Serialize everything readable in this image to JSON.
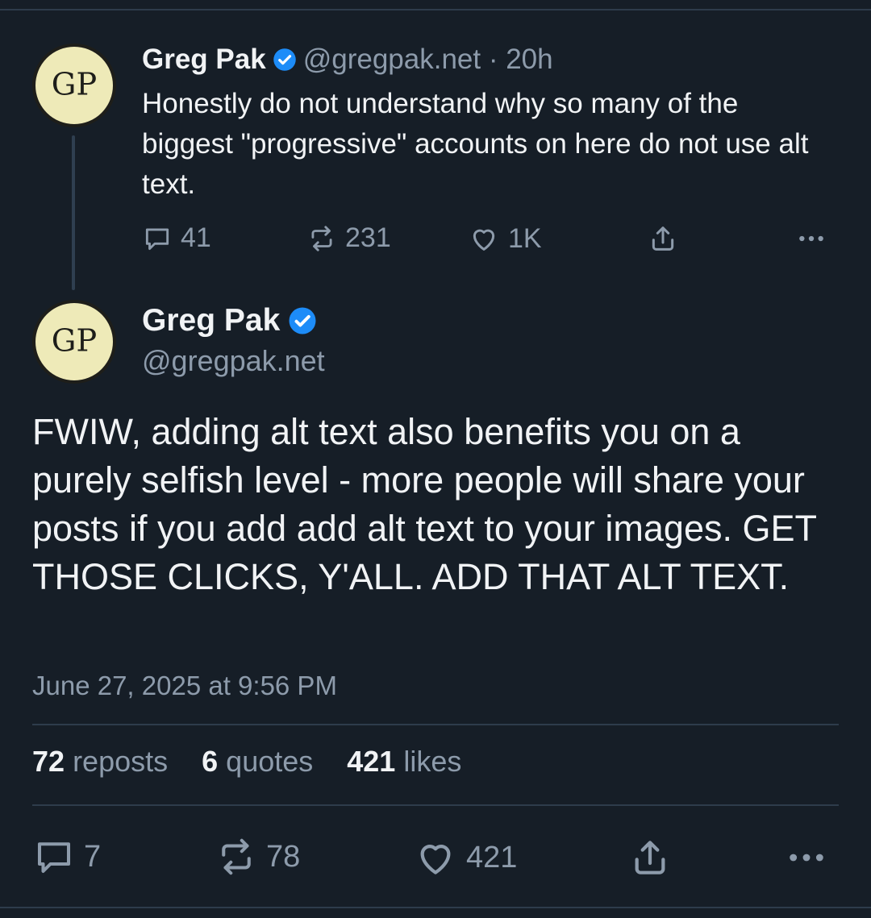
{
  "parent_post": {
    "author_name": "Greg Pak",
    "handle_time": "@gregpak.net · 20h",
    "text": "Honestly do not understand why so many of the biggest \"progressive\" accounts on here do not use alt text.",
    "reply_count": "41",
    "repost_count": "231",
    "like_count": "1K"
  },
  "main_post": {
    "author_name": "Greg Pak",
    "handle": "@gregpak.net",
    "text": "FWIW, adding alt text also benefits you on a purely selfish level - more people will share your posts if you add add alt text to your images. GET THOSE CLICKS, Y'ALL. ADD THAT ALT TEXT.",
    "timestamp": "June 27, 2025 at 9:56 PM",
    "stats": {
      "reposts_count": "72",
      "reposts_label": "reposts",
      "quotes_count": "6",
      "quotes_label": "quotes",
      "likes_count": "421",
      "likes_label": "likes"
    },
    "reply_count": "7",
    "repost_count": "78",
    "like_count": "421"
  },
  "avatar": {
    "initials": "GP"
  },
  "colors": {
    "background": "#161e27",
    "verified_badge": "#1d8cf8",
    "muted_text": "#8d9bab",
    "avatar_bg": "#eeeab8"
  },
  "icons": [
    "reply-icon",
    "repost-icon",
    "like-icon",
    "share-icon",
    "more-icon",
    "verified-badge-icon"
  ]
}
